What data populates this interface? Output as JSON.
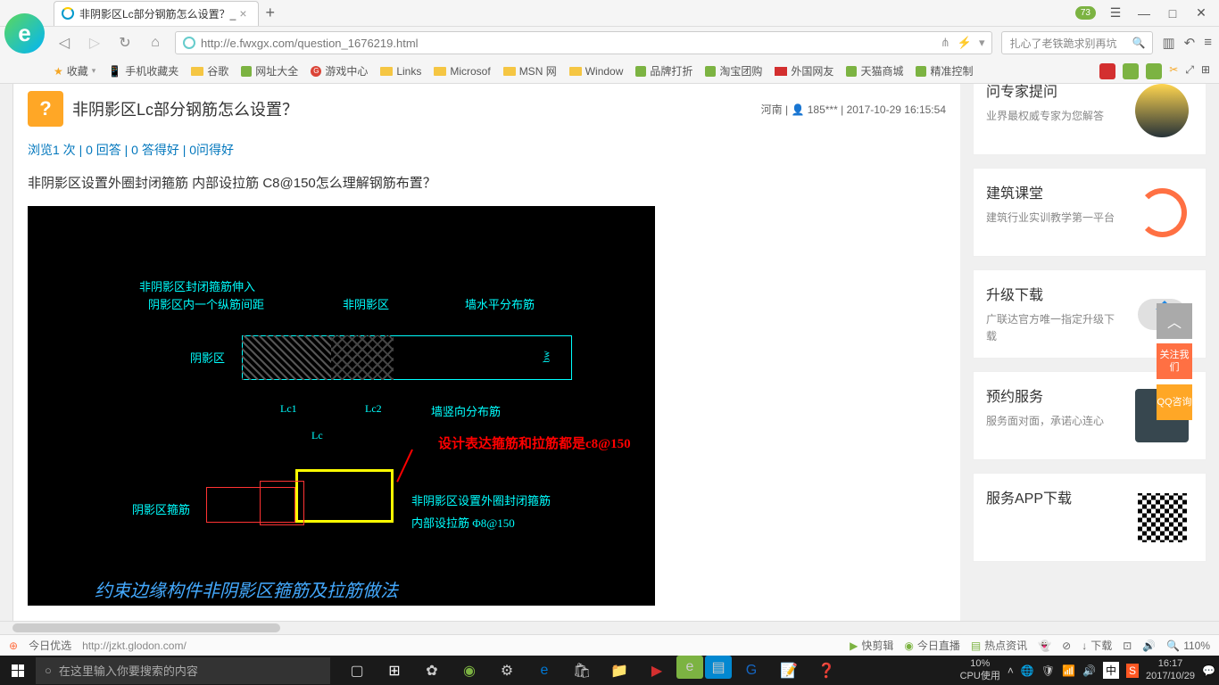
{
  "titlebar": {
    "tab_title": "非阴影区Lc部分钢筋怎么设置？_",
    "badge": "73"
  },
  "addressbar": {
    "url": "http://e.fwxgx.com/question_1676219.html",
    "search_placeholder": "扎心了老铁跪求别再坑"
  },
  "bookmarks": {
    "fav": "收藏",
    "items": [
      "手机收藏夹",
      "谷歌",
      "网址大全",
      "游戏中心",
      "Links",
      "Microsof",
      "MSN 网",
      "Window",
      "品牌打折",
      "淘宝团购",
      "外国网友",
      "天猫商城",
      "精准控制"
    ]
  },
  "question": {
    "title": "非阴影区Lc部分钢筋怎么设置？",
    "location": "河南",
    "user": "185***",
    "time": "2017-10-29 16:15:54",
    "stats": "浏览1 次 | 0 回答 | 0 答得好 | 0问得好",
    "description": "非阴影区设置外圈封闭箍筋 内部设拉筋 C8@150怎么理解钢筋布置？"
  },
  "cad": {
    "label1": "非阴影区封闭箍筋伸入",
    "label2": "阴影区内一个纵筋间距",
    "label3": "非阴影区",
    "label4": "墙水平分布筋",
    "label5": "阴影区",
    "label6": "Lc1",
    "label7": "Lc2",
    "label8": "墙竖向分布筋",
    "label9": "Lc",
    "label10": "bw",
    "annotation": "设计表达箍筋和拉筋都是c8@150",
    "label11": "阴影区箍筋",
    "label12": "非阴影区设置外圈封闭箍筋",
    "label13": "内部设拉筋 Φ8@150",
    "label14": "约束边缘构件非阴影区箍筋及拉筋做法"
  },
  "sidebar": {
    "cards": [
      {
        "title": "问专家提问",
        "desc": "业界最权威专家为您解答"
      },
      {
        "title": "建筑课堂",
        "desc": "建筑行业实训教学第一平台"
      },
      {
        "title": "升级下载",
        "desc": "广联达官方唯一指定升级下载"
      },
      {
        "title": "预约服务",
        "desc": "服务面对面，承诺心连心"
      },
      {
        "title": "服务APP下载",
        "desc": ""
      }
    ]
  },
  "edge": {
    "follow": "关注我们",
    "qq": "QQ咨询"
  },
  "statusbar": {
    "today": "今日优选",
    "url": "http://jzkt.glodon.com/",
    "items": [
      "快剪辑",
      "今日直播",
      "热点资讯",
      "",
      "",
      "下载",
      "",
      "",
      "110%"
    ]
  },
  "taskbar": {
    "search_placeholder": "在这里输入你要搜索的内容",
    "cpu_pct": "10%",
    "cpu_label": "CPU使用",
    "time": "16:17",
    "date": "2017/10/29",
    "ime": "中"
  }
}
